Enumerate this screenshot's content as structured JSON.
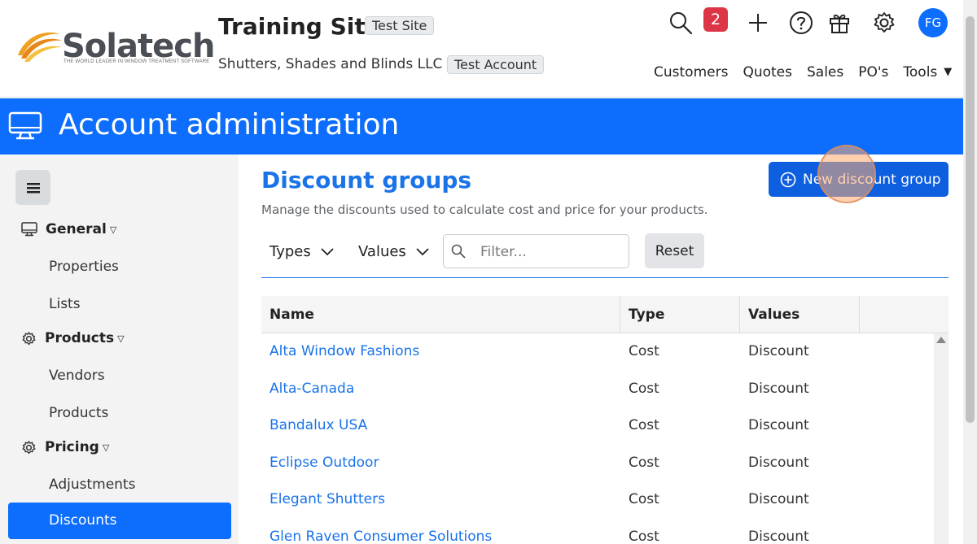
{
  "header": {
    "logo_text": "Solatech",
    "logo_tagline": "THE WORLD LEADER IN WINDOW TREATMENT SOFTWARE",
    "site_title": "Training Site",
    "site_badge": "Test Site",
    "company_name": "Shutters, Shades and Blinds LLC",
    "account_badge": "Test Account",
    "notification_count": "2",
    "avatar_initials": "FG",
    "nav": [
      "Customers",
      "Quotes",
      "Sales",
      "PO's",
      "Tools"
    ]
  },
  "banner": {
    "title": "Account administration"
  },
  "sidebar": {
    "groups": [
      {
        "label": "General",
        "icon": "monitor-icon",
        "items": [
          "Properties",
          "Lists"
        ]
      },
      {
        "label": "Products",
        "icon": "gear-icon",
        "items": [
          "Vendors",
          "Products"
        ]
      },
      {
        "label": "Pricing",
        "icon": "gear-icon",
        "items": [
          "Adjustments",
          "Discounts"
        ]
      }
    ],
    "active_item": "Discounts"
  },
  "main": {
    "title": "Discount groups",
    "subtitle": "Manage the discounts used to calculate cost and price for your products.",
    "new_button": "New discount group",
    "filters": {
      "types_label": "Types",
      "values_label": "Values",
      "search_placeholder": "Filter...",
      "reset_label": "Reset"
    },
    "table": {
      "columns": [
        "Name",
        "Type",
        "Values"
      ],
      "rows": [
        {
          "name": "Alta Window Fashions",
          "type": "Cost",
          "value": "Discount"
        },
        {
          "name": "Alta-Canada",
          "type": "Cost",
          "value": "Discount"
        },
        {
          "name": "Bandalux USA",
          "type": "Cost",
          "value": "Discount"
        },
        {
          "name": "Eclipse Outdoor",
          "type": "Cost",
          "value": "Discount"
        },
        {
          "name": "Elegant Shutters",
          "type": "Cost",
          "value": "Discount"
        },
        {
          "name": "Glen Raven Consumer Solutions",
          "type": "Cost",
          "value": "Discount"
        }
      ]
    }
  },
  "colors": {
    "primary": "#0d6efd",
    "link": "#1a73e8",
    "badge_red": "#dc3545"
  }
}
